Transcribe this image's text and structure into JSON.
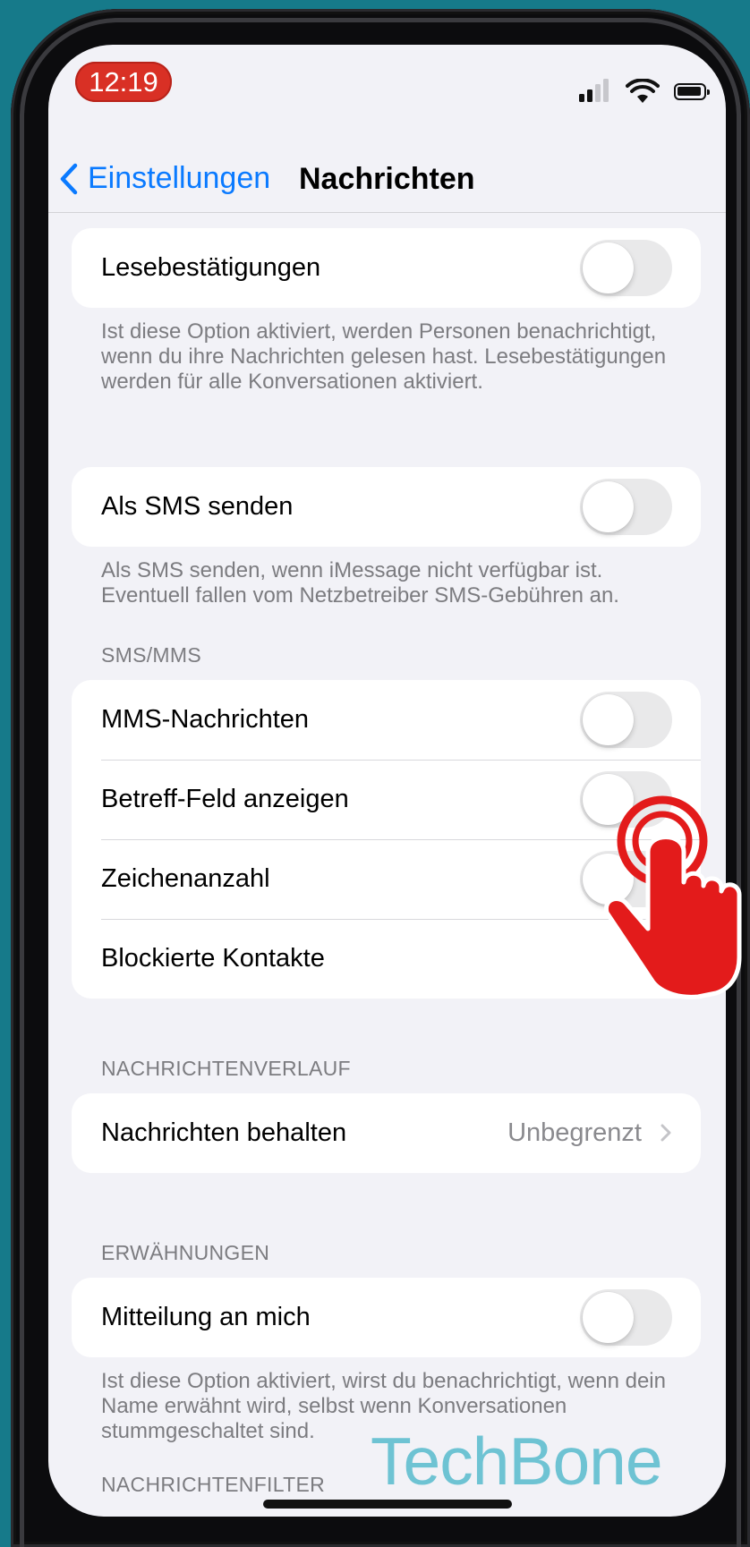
{
  "status_bar": {
    "time": "12:19"
  },
  "nav": {
    "back_label": "Einstellungen",
    "title": "Nachrichten"
  },
  "sections": {
    "read_receipts": {
      "label": "Lesebestätigungen",
      "enabled": false,
      "footer": "Ist diese Option aktiviert, werden Personen benachrichtigt, wenn du ihre Nachrichten gelesen hast. Lesebestätigungen werden für alle Konversationen aktiviert."
    },
    "send_as_sms": {
      "label": "Als SMS senden",
      "enabled": false,
      "footer": "Als SMS senden, wenn iMessage nicht verfügbar ist. Eventuell fallen vom Netzbetreiber SMS-Gebühren an."
    },
    "sms_mms": {
      "header": "SMS/MMS",
      "rows": [
        {
          "label": "MMS-Nachrichten",
          "enabled": false
        },
        {
          "label": "Betreff-Feld anzeigen",
          "enabled": false
        },
        {
          "label": "Zeichenanzahl",
          "enabled": false
        },
        {
          "label": "Blockierte Kontakte"
        }
      ]
    },
    "message_history": {
      "header": "NACHRICHTENVERLAUF",
      "label": "Nachrichten behalten",
      "value": "Unbegrenzt"
    },
    "mentions": {
      "header": "ERWÄHNUNGEN",
      "label": "Mitteilung an mich",
      "enabled": false,
      "footer": "Ist diese Option aktiviert, wirst du benachrichtigt, wenn dein Name erwähnt wird, selbst wenn Konversationen stummgeschaltet sind."
    },
    "message_filter": {
      "header": "NACHRICHTENFILTER"
    }
  },
  "watermark": "TechBone",
  "colors": {
    "accent": "#0a7aff",
    "background": "#167a8a",
    "time_pill": "#d93025",
    "tap_indicator": "#e31b1b",
    "watermark": "#6ec3d3"
  }
}
